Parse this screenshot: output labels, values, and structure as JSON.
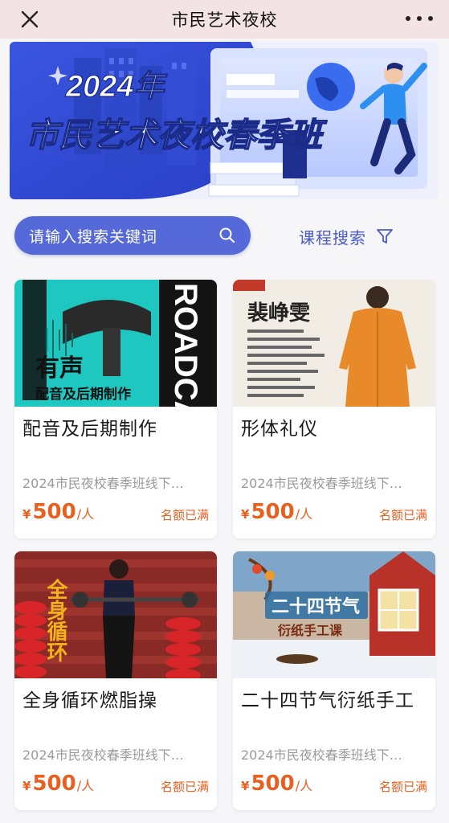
{
  "topbar": {
    "title": "市民艺术夜校"
  },
  "banner": {
    "year_text": "2024年",
    "headline": "市民艺术夜校春季班"
  },
  "search": {
    "placeholder": "请输入搜索关键词",
    "filter_label": "课程搜索"
  },
  "courses": [
    {
      "name": "配音及后期制作",
      "subtitle": "2024市民夜校春季班线下…",
      "price_currency": "¥",
      "price_value": "500",
      "price_unit": "/人",
      "status": "名额已满",
      "thumb_text_main": "有声",
      "thumb_text_sub": "配音及后期制作",
      "thumb_side_text": "ROADCA"
    },
    {
      "name": "形体礼仪",
      "subtitle": "2024市民夜校春季班线下…",
      "price_currency": "¥",
      "price_value": "500",
      "price_unit": "/人",
      "status": "名额已满",
      "thumb_text_main": "裴峥雯"
    },
    {
      "name": "全身循环燃脂操",
      "subtitle": "2024市民夜校春季班线下…",
      "price_currency": "¥",
      "price_value": "500",
      "price_unit": "/人",
      "status": "名额已满",
      "thumb_text_main": "全身循环"
    },
    {
      "name": "二十四节气衍纸手工",
      "subtitle": "2024市民夜校春季班线下…",
      "price_currency": "¥",
      "price_value": "500",
      "price_unit": "/人",
      "status": "名额已满",
      "thumb_text_main": "二十四节气",
      "thumb_text_sub": "衍纸手工课"
    }
  ],
  "colors": {
    "accent": "#5569d8",
    "price": "#e8601f",
    "topbar_bg": "#f3e3e5"
  }
}
